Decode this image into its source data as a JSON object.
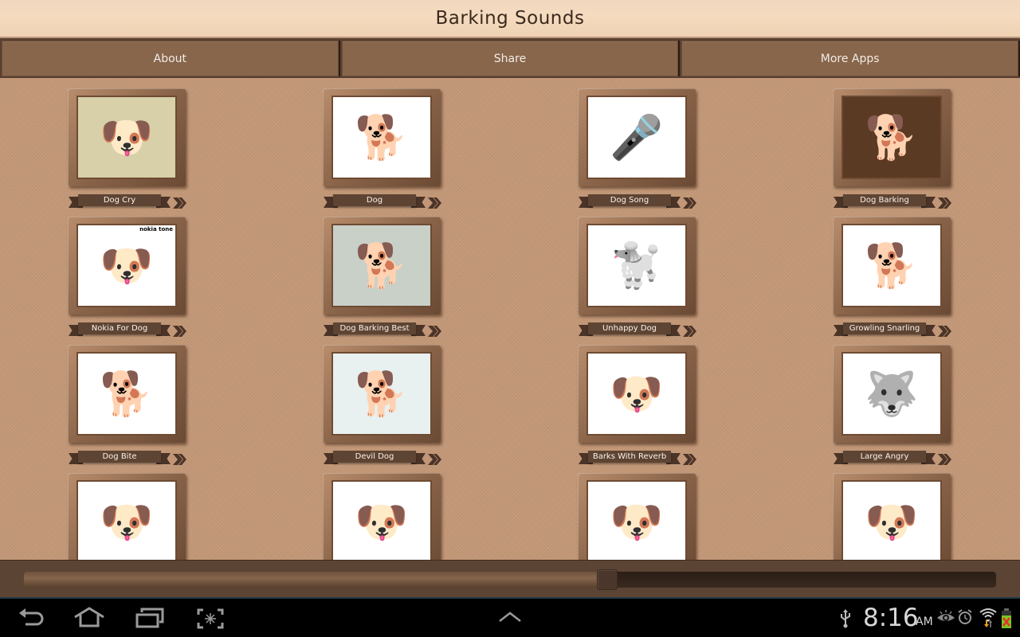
{
  "app": {
    "title": "Barking Sounds",
    "nav": [
      {
        "label": "About"
      },
      {
        "label": "Share"
      },
      {
        "label": "More Apps"
      }
    ]
  },
  "sounds": [
    {
      "label": "Dog Cry",
      "icon": "dog-photo",
      "glyph": "🐶",
      "bg": "#d8d0a8"
    },
    {
      "label": "Dog",
      "icon": "dog-photo",
      "glyph": "🐕",
      "bg": "#ffffff"
    },
    {
      "label": "Dog Song",
      "icon": "dog-photo",
      "glyph": "🎤",
      "bg": "#ffffff"
    },
    {
      "label": "Dog Barking",
      "icon": "dog-photo",
      "glyph": "🐕",
      "bg": "#5a3a22"
    },
    {
      "label": "Nokia For Dog",
      "icon": "dog-photo",
      "glyph": "🐶",
      "bg": "#ffffff",
      "caption": "nokia tone"
    },
    {
      "label": "Dog Barking Best",
      "icon": "dog-photo",
      "glyph": "🐕",
      "bg": "#c8d0c8"
    },
    {
      "label": "Unhappy Dog",
      "icon": "dog-photo",
      "glyph": "🐩",
      "bg": "#ffffff"
    },
    {
      "label": "Growling Snarling",
      "icon": "dog-photo",
      "glyph": "🐕",
      "bg": "#ffffff"
    },
    {
      "label": "Dog Bite",
      "icon": "dog-photo",
      "glyph": "🐕",
      "bg": "#ffffff"
    },
    {
      "label": "Devil Dog",
      "icon": "dog-photo",
      "glyph": "🐕",
      "bg": "#e8f0f0"
    },
    {
      "label": "Barks With Reverb",
      "icon": "dog-photo",
      "glyph": "🐶",
      "bg": "#ffffff"
    },
    {
      "label": "Large Angry",
      "icon": "dog-photo",
      "glyph": "🐺",
      "bg": "#ffffff"
    },
    {
      "label": "",
      "icon": "dog-photo",
      "glyph": "🐶",
      "bg": "#ffffff"
    },
    {
      "label": "",
      "icon": "dog-photo",
      "glyph": "🐶",
      "bg": "#ffffff"
    },
    {
      "label": "",
      "icon": "dog-photo",
      "glyph": "🐶",
      "bg": "#ffffff"
    },
    {
      "label": "",
      "icon": "dog-photo",
      "glyph": "🐶",
      "bg": "#ffffff"
    }
  ],
  "player": {
    "progress": 0.6
  },
  "system": {
    "time": "8:16",
    "ampm": "AM",
    "nav_icons": [
      "back-icon",
      "home-icon",
      "recent-apps-icon",
      "screenshot-icon",
      "up-chevron-icon"
    ],
    "status_icons": [
      "usb-icon",
      "eye-icon",
      "alarm-icon",
      "wifi-icon",
      "battery-icon"
    ],
    "battery_color": "#7bc520",
    "battery_alert_color": "#e8302a",
    "wifi_arrow_down_color": "#f0a020"
  }
}
